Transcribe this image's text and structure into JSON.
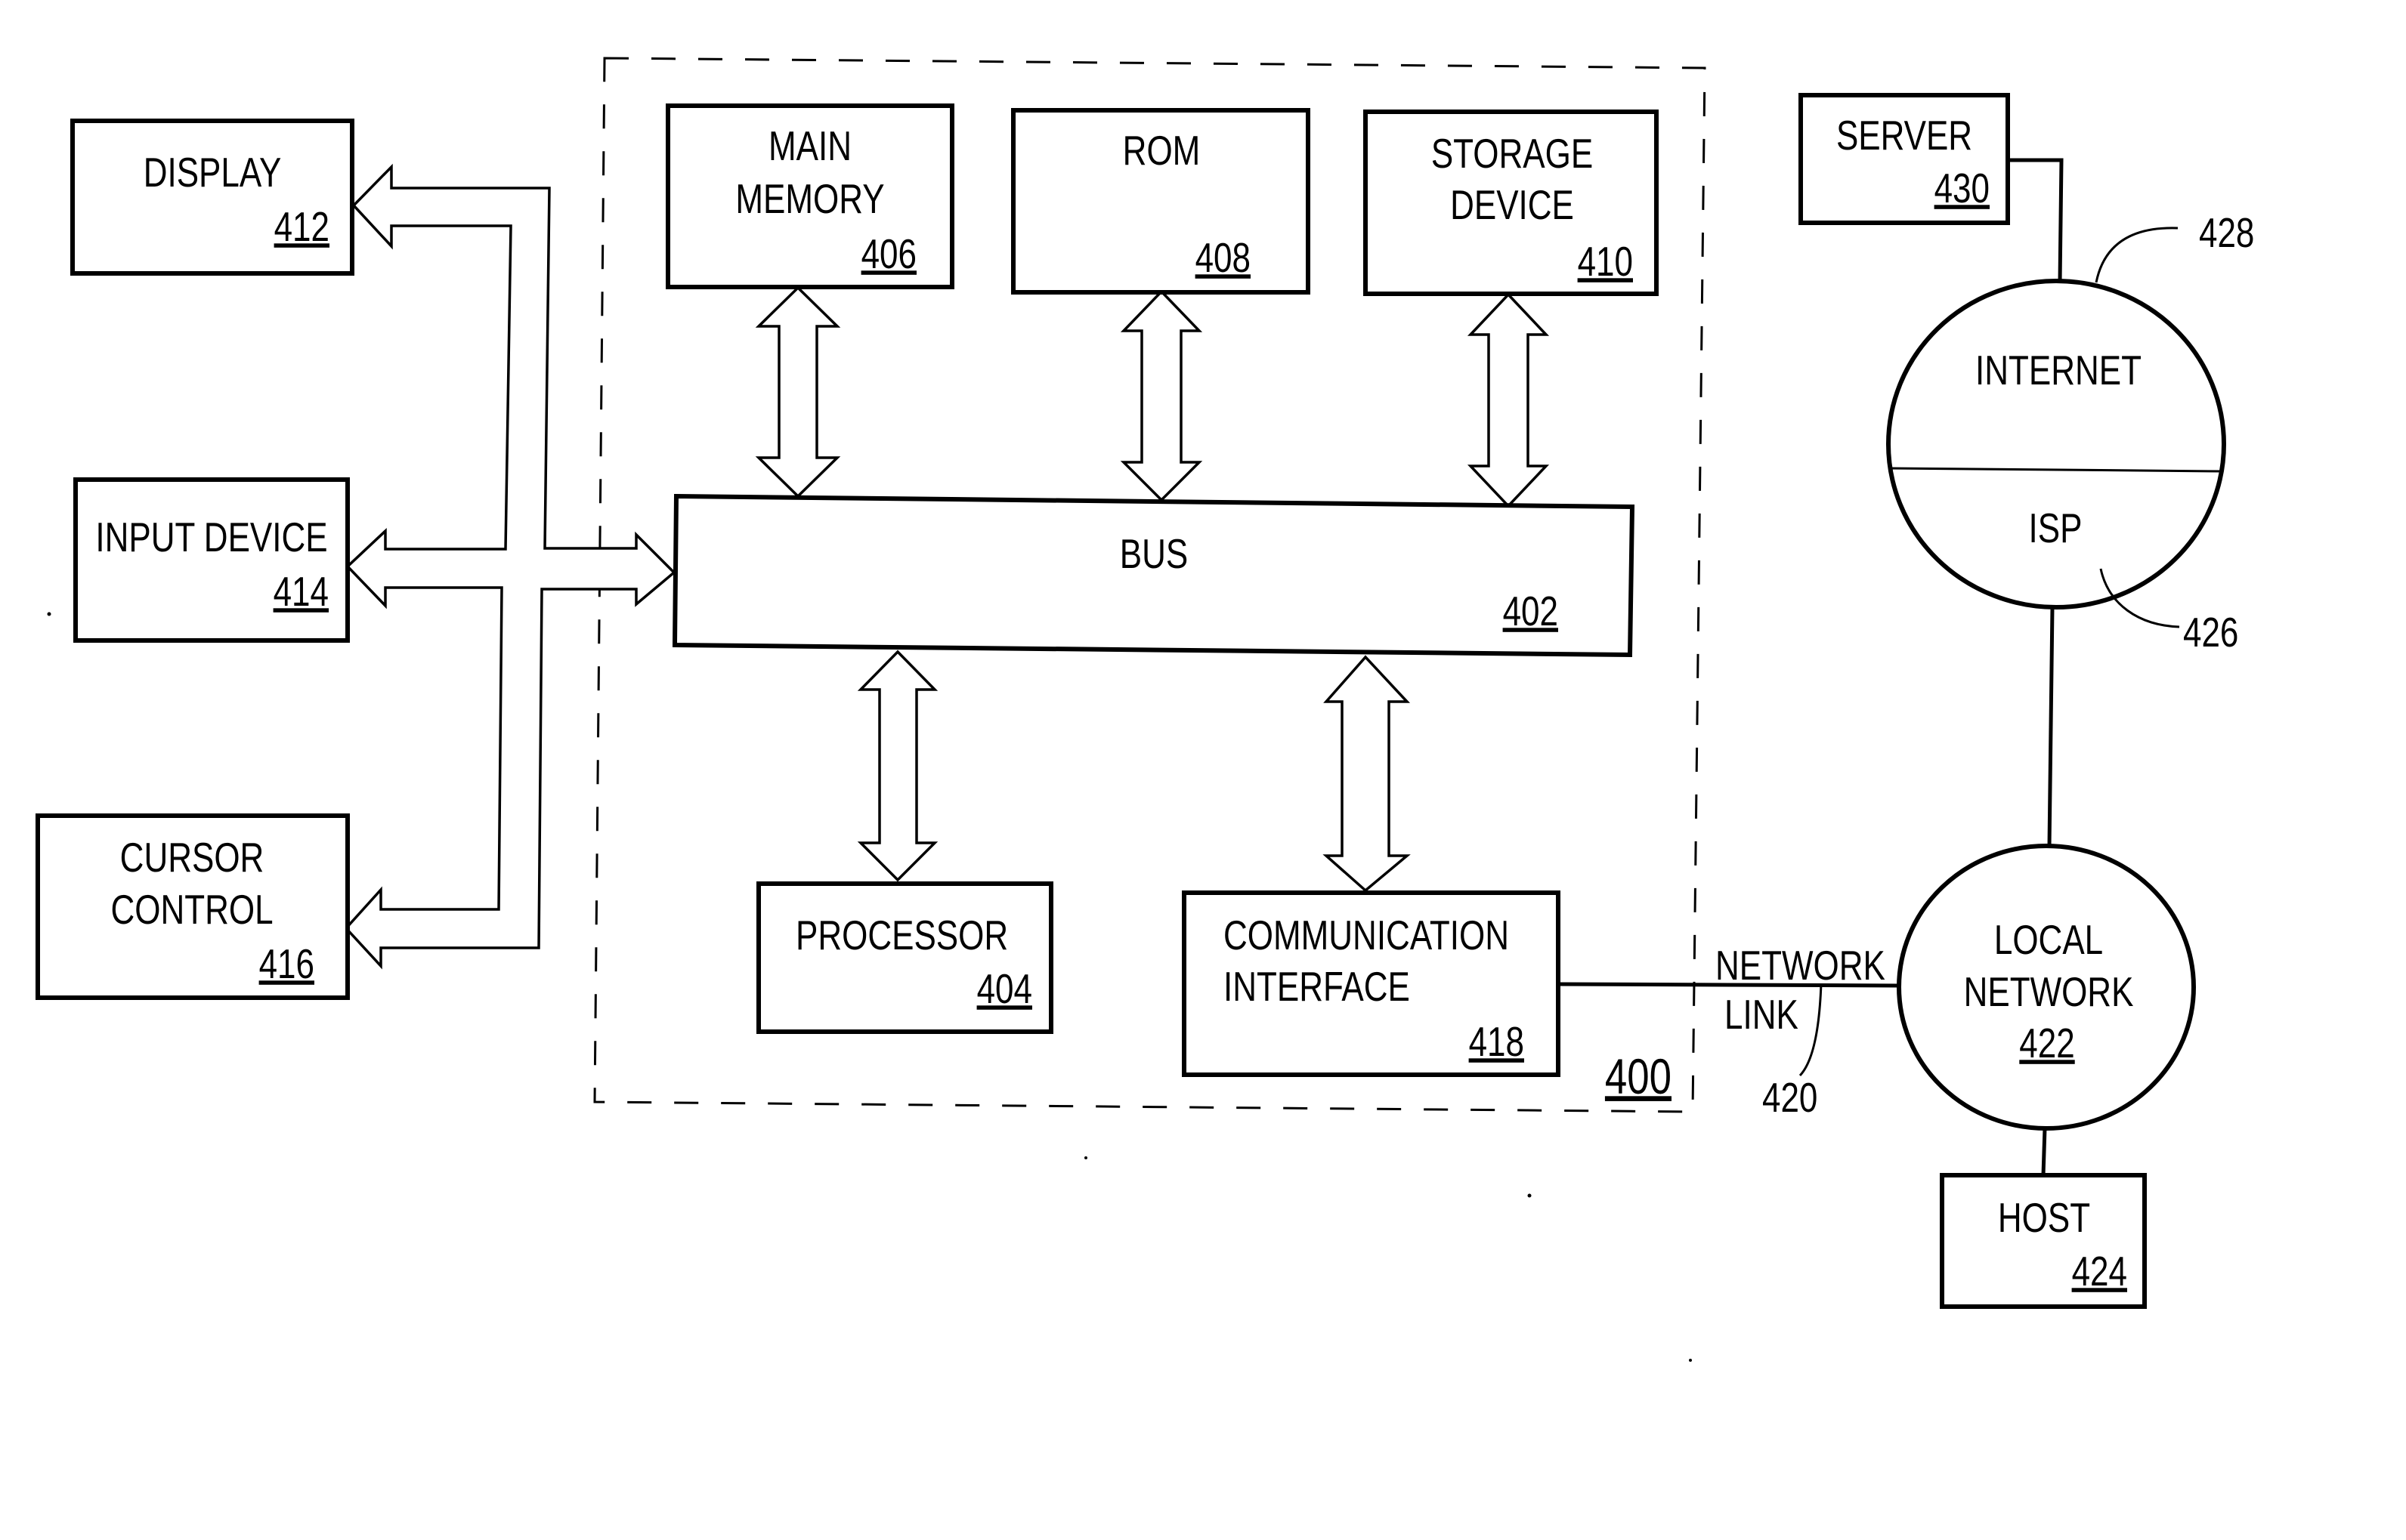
{
  "figure": {
    "system_ref": "400",
    "colors": {
      "ink": "#000000",
      "paper": "#ffffff"
    }
  },
  "components": {
    "display": {
      "lines": [
        "DISPLAY"
      ],
      "ref": "412"
    },
    "input_device": {
      "lines": [
        "INPUT DEVICE"
      ],
      "ref": "414"
    },
    "cursor_control": {
      "lines": [
        "CURSOR",
        "CONTROL"
      ],
      "ref": "416"
    },
    "main_memory": {
      "lines": [
        "MAIN",
        "MEMORY"
      ],
      "ref": "406"
    },
    "rom": {
      "lines": [
        "ROM"
      ],
      "ref": "408"
    },
    "storage_device": {
      "lines": [
        "STORAGE",
        "DEVICE"
      ],
      "ref": "410"
    },
    "bus": {
      "lines": [
        "BUS"
      ],
      "ref": "402"
    },
    "processor": {
      "lines": [
        "PROCESSOR"
      ],
      "ref": "404"
    },
    "communication_interface": {
      "lines": [
        "COMMUNICATION",
        "INTERFACE"
      ],
      "ref": "418"
    },
    "server": {
      "lines": [
        "SERVER"
      ],
      "ref": "430"
    },
    "host": {
      "lines": [
        "HOST"
      ],
      "ref": "424"
    }
  },
  "networks": {
    "internet": {
      "label": "INTERNET",
      "ref": "428"
    },
    "isp": {
      "label": "ISP",
      "ref": "426"
    },
    "local_network": {
      "lines": [
        "LOCAL",
        "NETWORK"
      ],
      "ref": "422"
    },
    "network_link": {
      "lines": [
        "NETWORK",
        "LINK"
      ],
      "ref": "420"
    }
  }
}
